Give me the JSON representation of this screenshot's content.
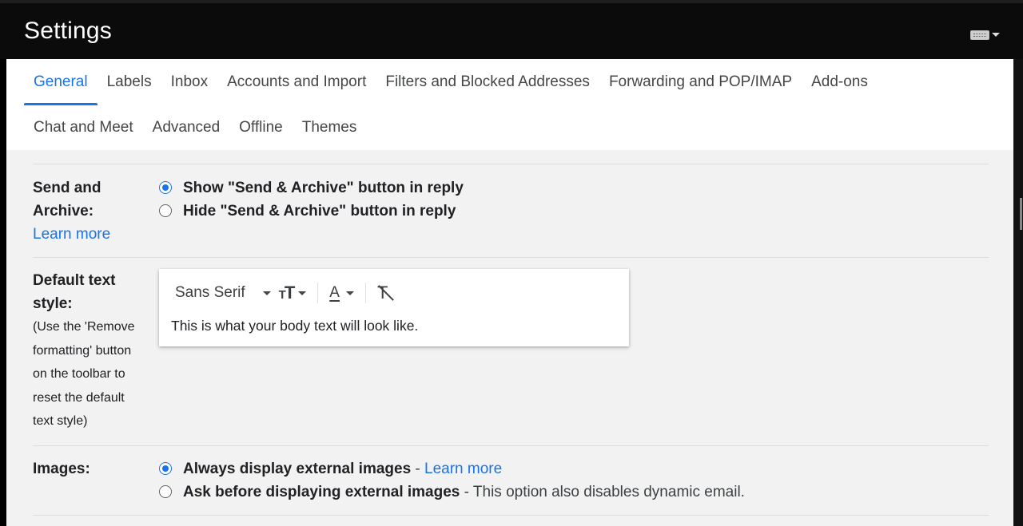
{
  "header": {
    "title": "Settings",
    "input_tools_icon": "keyboard-icon"
  },
  "tabs": {
    "row1": [
      {
        "label": "General",
        "active": true
      },
      {
        "label": "Labels"
      },
      {
        "label": "Inbox"
      },
      {
        "label": "Accounts and Import"
      },
      {
        "label": "Filters and Blocked Addresses"
      },
      {
        "label": "Forwarding and POP/IMAP"
      },
      {
        "label": "Add-ons"
      }
    ],
    "row2": [
      {
        "label": "Chat and Meet"
      },
      {
        "label": "Advanced"
      },
      {
        "label": "Offline"
      },
      {
        "label": "Themes"
      }
    ]
  },
  "send_archive": {
    "label_line1": "Send and",
    "label_line2": "Archive:",
    "learn_more": "Learn more",
    "option_show": "Show \"Send & Archive\" button in reply",
    "option_hide": "Hide \"Send & Archive\" button in reply",
    "selected": "show"
  },
  "text_style": {
    "label_line1": "Default text",
    "label_line2": "style:",
    "help_lines": [
      "(Use the 'Remove",
      "formatting' button",
      "on the toolbar to",
      "reset the default",
      "text style)"
    ],
    "font": "Sans Serif",
    "size_icon": "text-size-icon",
    "color_icon": "text-color-icon",
    "clear_icon": "remove-formatting-icon",
    "sample_text": "This is what your body text will look like."
  },
  "images": {
    "label": "Images:",
    "option_always": "Always display external images",
    "option_always_sep": " - ",
    "learn_more": "Learn more",
    "option_ask": "Ask before displaying external images",
    "option_ask_note": " - This option also disables dynamic email.",
    "selected": "always"
  },
  "colors": {
    "accent": "#1a73e8",
    "panel": "#f2f2f2",
    "header": "#0b0b0b"
  }
}
